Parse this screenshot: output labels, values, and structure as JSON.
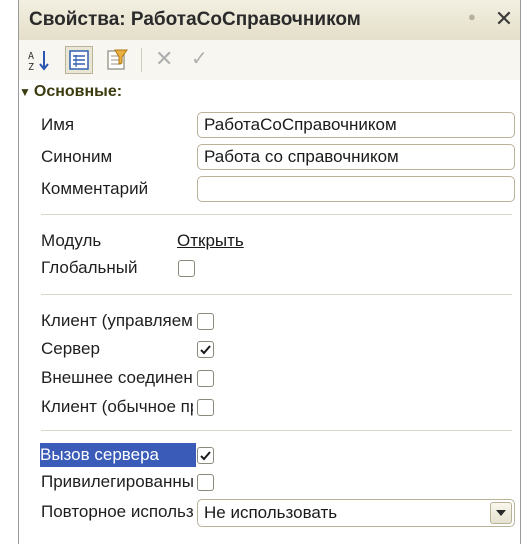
{
  "window": {
    "title": "Свойства: РаботаСоСправочником",
    "pin_icon": "pin-icon",
    "close_label": "✕"
  },
  "toolbar": {
    "sort_icon": "sort-az-icon",
    "categories_icon": "categories-icon",
    "filter_icon": "filter-icon",
    "cancel_label": "✕",
    "apply_label": "✓"
  },
  "group": {
    "title": "Основные:"
  },
  "props": {
    "name": {
      "label": "Имя",
      "value": "РаботаСоСправочником"
    },
    "synonym": {
      "label": "Синоним",
      "value": "Работа со справочником"
    },
    "comment": {
      "label": "Комментарий",
      "value": ""
    },
    "module": {
      "label": "Модуль",
      "link": "Открыть"
    },
    "global": {
      "label": "Глобальный",
      "checked": false
    },
    "client_managed": {
      "label": "Клиент (управляемое приложение)",
      "checked": false
    },
    "server": {
      "label": "Сервер",
      "checked": true
    },
    "external": {
      "label": "Внешнее соединение",
      "checked": false
    },
    "client_ordinary": {
      "label": "Клиент (обычное приложение)",
      "checked": false
    },
    "server_call": {
      "label": "Вызов сервера",
      "checked": true
    },
    "privileged": {
      "label": "Привилегированный",
      "checked": false
    },
    "reuse": {
      "label": "Повторное использование возвращаемых значений",
      "value": "Не использовать"
    }
  }
}
